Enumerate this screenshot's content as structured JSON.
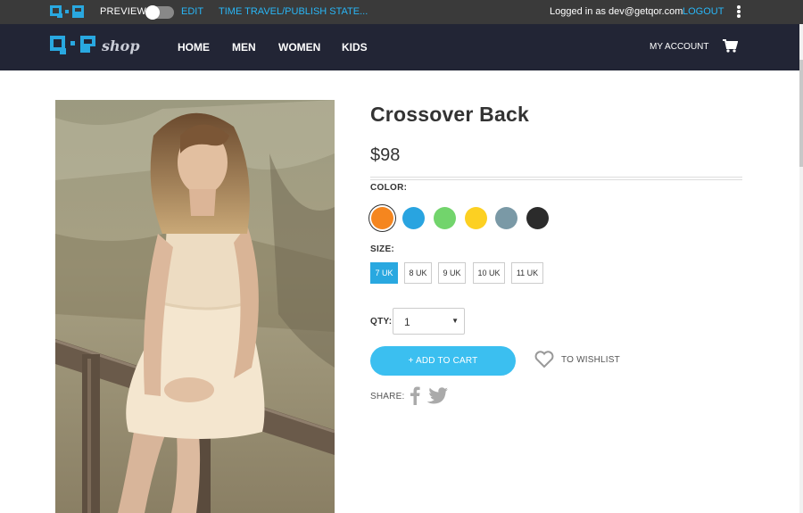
{
  "topbar": {
    "preview_label": "PREVIEW",
    "preview_on": false,
    "edit_label": "EDIT",
    "time_travel_label": "TIME TRAVEL/PUBLISH STATE...",
    "logged_in_text": "Logged in as dev@getqor.com",
    "logout_label": "LOGOUT",
    "more_icon": "kebab-menu-icon"
  },
  "navbar": {
    "brand_suffix": "shop",
    "links": [
      {
        "label": "HOME"
      },
      {
        "label": "MEN"
      },
      {
        "label": "WOMEN"
      },
      {
        "label": "KIDS"
      }
    ],
    "account_label": "MY ACCOUNT",
    "cart_icon": "shopping-cart-icon"
  },
  "product": {
    "title": "Crossover Back",
    "price": "$98",
    "color_label": "COLOR:",
    "colors": [
      {
        "name": "orange",
        "hex": "#f5861f",
        "selected": true
      },
      {
        "name": "blue",
        "hex": "#29a4e0",
        "selected": false
      },
      {
        "name": "green",
        "hex": "#72d46c",
        "selected": false
      },
      {
        "name": "yellow",
        "hex": "#fcd022",
        "selected": false
      },
      {
        "name": "slate",
        "hex": "#7a99a6",
        "selected": false
      },
      {
        "name": "black",
        "hex": "#2b2b2b",
        "selected": false
      }
    ],
    "size_label": "SIZE:",
    "sizes": [
      {
        "label": "7 UK",
        "active": true
      },
      {
        "label": "8 UK",
        "active": false
      },
      {
        "label": "9 UK",
        "active": false
      },
      {
        "label": "10 UK",
        "active": false
      },
      {
        "label": "11 UK",
        "active": false
      }
    ],
    "qty_label": "QTY:",
    "qty_value": "1",
    "add_to_cart_label": "+ ADD TO CART",
    "wishlist_label": "TO WISHLIST",
    "share_label": "SHARE:"
  },
  "colors": {
    "accent": "#29a8e0",
    "button": "#3bbff0",
    "topbar": "#3a3a3a",
    "navbar": "#222535"
  }
}
